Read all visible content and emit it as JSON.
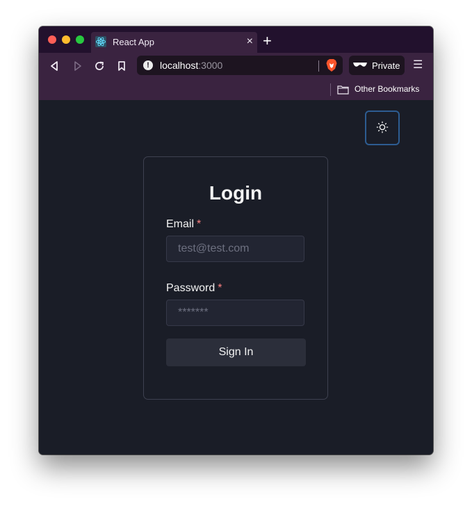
{
  "browser": {
    "tab": {
      "title": "React App",
      "favicon": "react-icon",
      "close": "×"
    },
    "new_tab": "+",
    "address": {
      "host": "localhost",
      "port": ":3000"
    },
    "private_label": "Private",
    "menu": "☰",
    "bookmarks": {
      "folder": "Other Bookmarks"
    }
  },
  "login": {
    "title": "Login",
    "email": {
      "label": "Email",
      "required": "*",
      "placeholder": "test@test.com"
    },
    "password": {
      "label": "Password",
      "required": "*",
      "placeholder": "*******"
    },
    "submit": "Sign In"
  },
  "colors": {
    "page_bg": "#1a1d27",
    "toolbar_bg": "#3a2340",
    "required": "#fc8181",
    "focus_ring": "#2d5c91"
  }
}
